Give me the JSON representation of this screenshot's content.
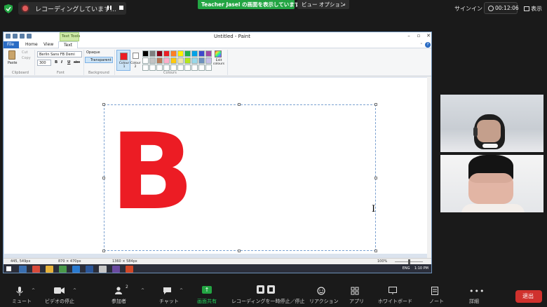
{
  "topbar": {
    "recording_text": "レコーディングしています...",
    "share_banner": "Teacher Jasel の画面を表示しています",
    "view_options": "ビュー オプション",
    "signin": "サインイン",
    "timer": "00:12:06",
    "display": "表示"
  },
  "paint": {
    "title": "Untitled - Paint",
    "text_tools_tab": "Text Tools",
    "tabs": {
      "file": "File",
      "home": "Home",
      "view": "View",
      "text": "Text"
    },
    "ribbon": {
      "paste": "Paste",
      "cut": "Cut",
      "copy": "Copy",
      "clipboard": "Clipboard",
      "font_name": "Berlin Sans FB Demi",
      "font_size": "300",
      "font_group": "Font",
      "bold": "B",
      "italic": "I",
      "underline": "U",
      "strikethrough": "abc",
      "opaque": "Opaque",
      "transparent": "Transparent",
      "background_group": "Background",
      "colour1": "Colour 1",
      "colour2": "Colour 2",
      "colours_group": "Colours",
      "edit_colours": "Edit colours"
    },
    "palette": [
      "#000000",
      "#7f7f7f",
      "#880015",
      "#ed1c24",
      "#ff7f27",
      "#fff200",
      "#22b14c",
      "#00a2e8",
      "#3f48cc",
      "#a349a4",
      "#ffffff",
      "#c3c3c3",
      "#b97a57",
      "#ffaec9",
      "#ffc90e",
      "#efe4b0",
      "#b5e61d",
      "#99d9ea",
      "#7092be",
      "#c8bfe7",
      "#ffffff",
      "#ffffff",
      "#ffffff",
      "#ffffff",
      "#ffffff",
      "#ffffff",
      "#ffffff",
      "#ffffff",
      "#ffffff",
      "#ffffff"
    ],
    "canvas_text": "B",
    "text_colour": "#ec1c24",
    "status": {
      "cursor": "445, 549px",
      "selection": "870 × 470px",
      "size": "1360 × 584px",
      "zoom": "100%"
    },
    "taskbar": {
      "lang": "ENG",
      "time": "1:10 PM"
    }
  },
  "toolbar": {
    "mute": "ミュート",
    "video_stop": "ビデオの停止",
    "participants": "参加者",
    "participants_count": "2",
    "chat": "チャット",
    "share_screen": "画面共有",
    "recording_ctrl": "レコーディングを一時停止／停止",
    "reactions": "リアクション",
    "apps": "アプリ",
    "whiteboard": "ホワイトボード",
    "notes": "ノート",
    "more": "詳細",
    "leave": "退出"
  }
}
